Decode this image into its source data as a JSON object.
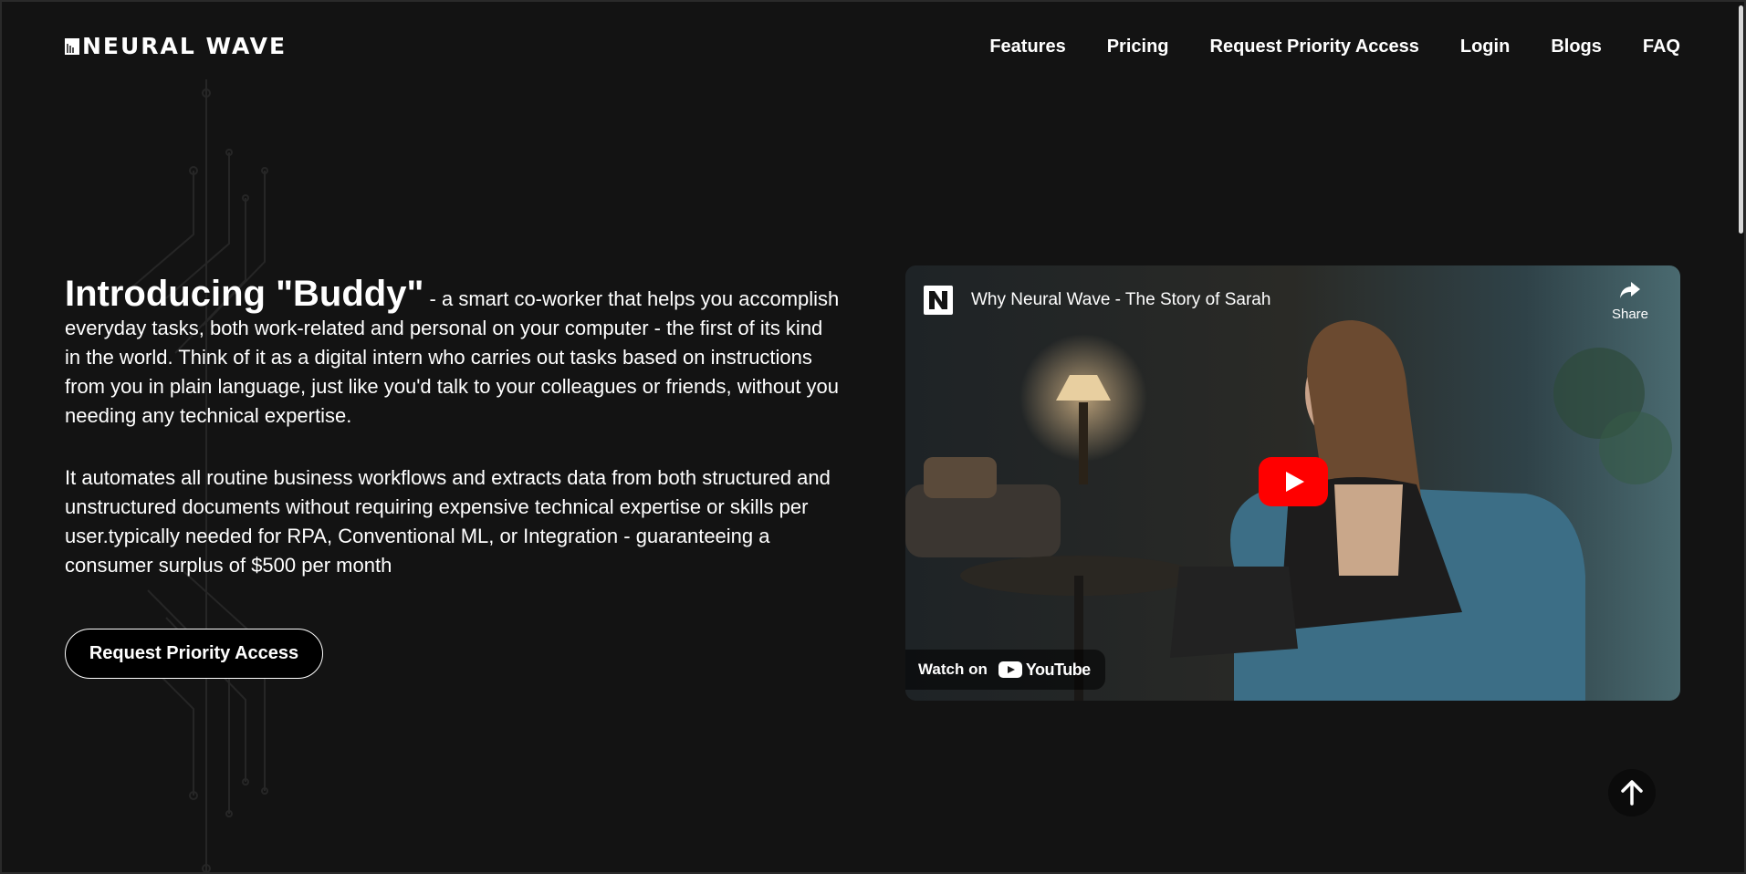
{
  "header": {
    "logo_text": "NEURAL WAVE",
    "nav": [
      "Features",
      "Pricing",
      "Request Priority Access",
      "Login",
      "Blogs",
      "FAQ"
    ]
  },
  "hero": {
    "title": "Introducing \"Buddy\"",
    "intro": " - a smart co-worker that helps you accomplish everyday tasks, both work-related and personal on your computer - the first of its kind in the world. Think of it as a digital intern who carries out tasks based on instructions from you in plain language, just like you'd talk to your colleagues or friends, without you needing any technical expertise.",
    "paragraph2": "It automates all routine business workflows and extracts data from both structured and unstructured documents without requiring expensive technical expertise or skills per user.typically needed for RPA, Conventional ML, or Integration - guaranteeing a consumer surplus of $500 per month",
    "cta_label": "Request Priority Access"
  },
  "video": {
    "title": "Why Neural Wave - The Story of Sarah",
    "share_label": "Share",
    "watch_on_label": "Watch on",
    "platform_label": "YouTube"
  },
  "colors": {
    "background": "#131313",
    "play_button": "#ff0000",
    "text": "#ffffff"
  }
}
